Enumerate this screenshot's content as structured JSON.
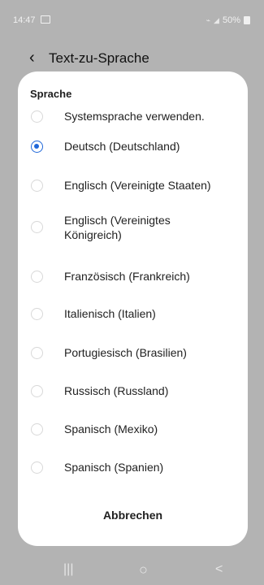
{
  "status_bar": {
    "time": "14:47",
    "battery": "50%"
  },
  "header": {
    "title": "Text-zu-Sprache"
  },
  "dialog": {
    "title": "Sprache",
    "options": [
      {
        "label": "Systemsprache verwenden.",
        "checked": false
      },
      {
        "label": "Deutsch (Deutschland)",
        "checked": true
      },
      {
        "label": "Englisch (Vereinigte Staaten)",
        "checked": false
      },
      {
        "label": "Englisch (Vereinigtes Königreich)",
        "checked": false
      },
      {
        "label": "Französisch (Frankreich)",
        "checked": false
      },
      {
        "label": "Italienisch (Italien)",
        "checked": false
      },
      {
        "label": "Portugiesisch (Brasilien)",
        "checked": false
      },
      {
        "label": "Russisch (Russland)",
        "checked": false
      },
      {
        "label": "Spanisch (Mexiko)",
        "checked": false
      },
      {
        "label": "Spanisch (Spanien)",
        "checked": false
      }
    ],
    "cancel_label": "Abbrechen"
  },
  "navigation": {
    "recent_icon": "|||",
    "home_icon": "○",
    "back_icon": "<"
  }
}
